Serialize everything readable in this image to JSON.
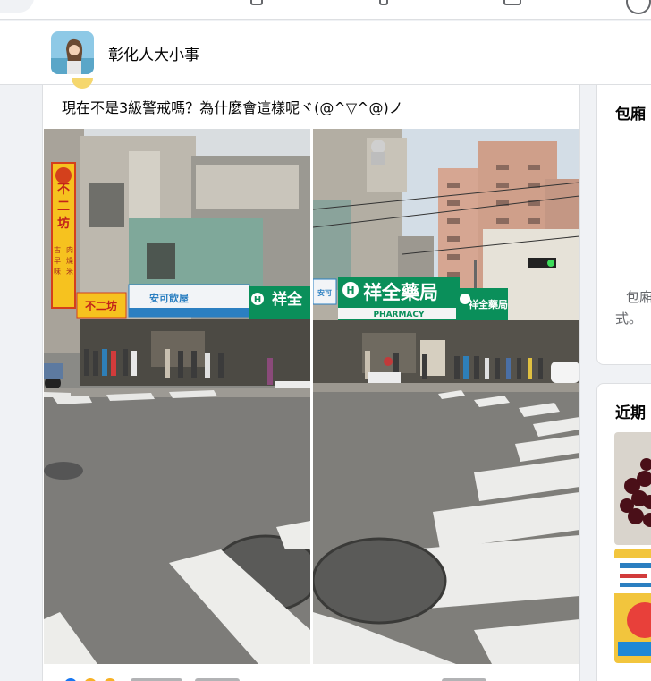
{
  "group": {
    "name": "彰化人大小事"
  },
  "post": {
    "text": "現在不是3級警戒嗎？為什麼會這樣呢ヾ(@^▽^@)ノ",
    "left_photo": {
      "shop_sign_vertical": "不二坊",
      "shop_sign_small": "不二坊",
      "shop_sub_lines": [
        "古早味",
        "肉燥",
        "米粉"
      ],
      "sign_blue": "安可飲屋",
      "sign_green": "祥全"
    },
    "right_photo": {
      "pharmacy_name": "祥全藥局",
      "pharmacy_sub": "PHARMACY",
      "pharmacy_side": "祥全藥局",
      "sign_left": "安可"
    }
  },
  "sidebar": {
    "card1_title": "包廂",
    "card1_body": [
      "包廂",
      "式。"
    ],
    "card2_title": "近期"
  },
  "colors": {
    "brand_blue": "#1877f2",
    "pharmacy_green": "#0a8f5a",
    "page_bg": "#f0f2f5"
  }
}
